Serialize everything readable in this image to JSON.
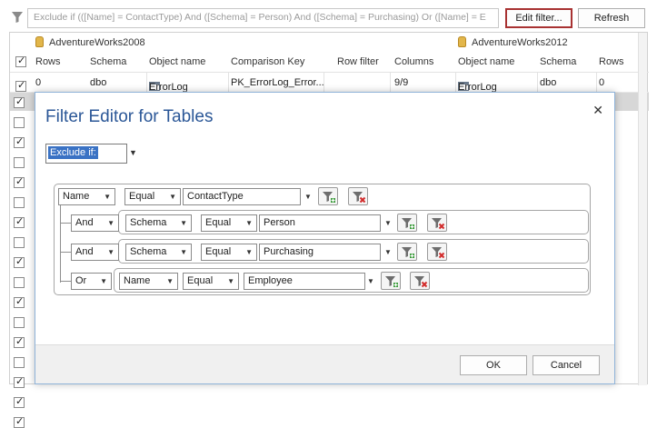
{
  "toolbar": {
    "filter_text": "Exclude if (([Name] = ContactType) And ([Schema] = Person) And ([Schema] = Purchasing) Or ([Name] = E",
    "edit_filter_label": "Edit filter...",
    "refresh_label": "Refresh"
  },
  "grid": {
    "db_left": "AdventureWorks2008",
    "db_right": "AdventureWorks2012",
    "columns": [
      "Rows",
      "Schema",
      "Object name",
      "Comparison Key",
      "Row filter",
      "Columns",
      "Object name",
      "Schema",
      "Rows"
    ],
    "row1": {
      "rows": "0",
      "schema": "dbo",
      "object_name": "ErrorLog",
      "comparison_key": "PK_ErrorLog_Error...",
      "row_filter": "",
      "columns": "9/9",
      "object_name_right": "ErrorLog",
      "schema_right": "dbo",
      "rows_right": "0"
    },
    "checkboxes": [
      true,
      true,
      true,
      false,
      true,
      false,
      true,
      false,
      true,
      false,
      true,
      false,
      true,
      false,
      true,
      false,
      true,
      true,
      true
    ]
  },
  "dialog": {
    "title": "Filter Editor for Tables",
    "mode": "Exclude if:",
    "conditions": [
      {
        "connector": "",
        "field": "Name",
        "operator": "Equal",
        "value": "ContactType"
      },
      {
        "connector": "And",
        "field": "Schema",
        "operator": "Equal",
        "value": "Person"
      },
      {
        "connector": "And",
        "field": "Schema",
        "operator": "Equal",
        "value": "Purchasing"
      },
      {
        "connector": "Or",
        "field": "Name",
        "operator": "Equal",
        "value": "Employee"
      }
    ],
    "ok_label": "OK",
    "cancel_label": "Cancel"
  }
}
